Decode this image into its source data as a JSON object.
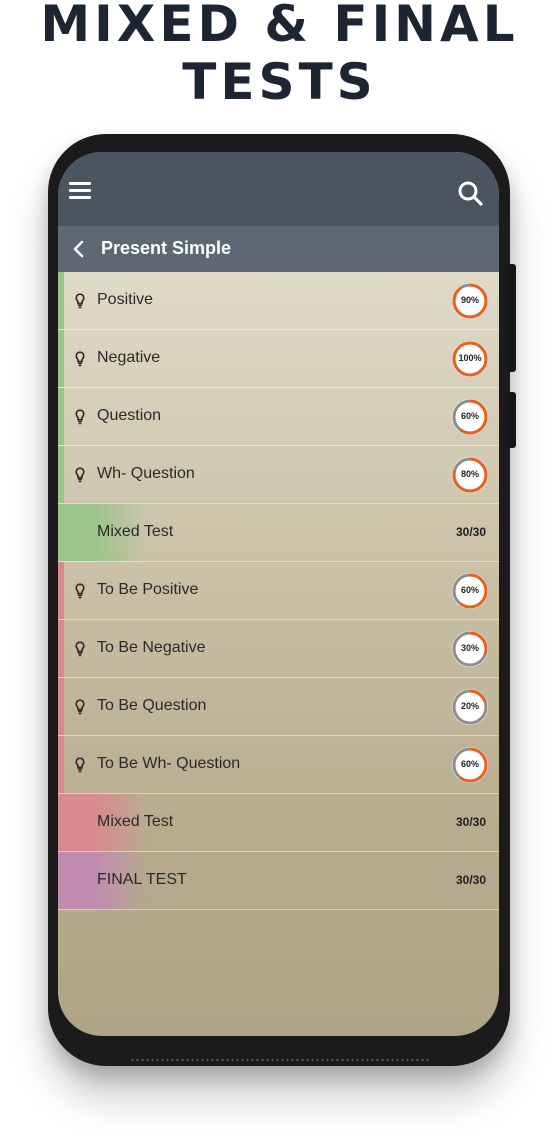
{
  "headline": {
    "line1": "MIXED & FINAL",
    "line2": "TESTS"
  },
  "appbar": {
    "menu_icon": "hamburger-menu-icon",
    "search_icon": "search-icon"
  },
  "subbar": {
    "back_icon": "chevron-left-icon",
    "title": "Present Simple"
  },
  "colors": {
    "appbar": "#4b5561",
    "subbar": "#5e6874",
    "ring_progress": "#e8611e",
    "ring_track": "#8d8d8d",
    "green_accent": "#9bc488",
    "red_accent": "#d88a8e",
    "purple_accent": "#c18bb0"
  },
  "list": [
    {
      "label": "Positive",
      "kind": "lesson",
      "percent_text": "90%",
      "progress": 0.9,
      "accent": "green"
    },
    {
      "label": "Negative",
      "kind": "lesson",
      "percent_text": "100%",
      "progress": 1.0,
      "accent": "green"
    },
    {
      "label": "Question",
      "kind": "lesson",
      "percent_text": "60%",
      "progress": 0.6,
      "accent": "green"
    },
    {
      "label": "Wh- Question",
      "kind": "lesson",
      "percent_text": "80%",
      "progress": 0.8,
      "accent": "green"
    },
    {
      "label": "Mixed Test",
      "kind": "test",
      "score": "30/30",
      "accent": "green"
    },
    {
      "label": "To Be Positive",
      "kind": "lesson",
      "percent_text": "60%",
      "progress": 0.6,
      "accent": "red"
    },
    {
      "label": "To Be Negative",
      "kind": "lesson",
      "percent_text": "30%",
      "progress": 0.3,
      "accent": "red"
    },
    {
      "label": "To Be Question",
      "kind": "lesson",
      "percent_text": "20%",
      "progress": 0.2,
      "accent": "red"
    },
    {
      "label": "To Be Wh- Question",
      "kind": "lesson",
      "percent_text": "60%",
      "progress": 0.6,
      "accent": "red"
    },
    {
      "label": "Mixed Test",
      "kind": "test",
      "score": "30/30",
      "accent": "red"
    },
    {
      "label": "FINAL TEST",
      "kind": "test",
      "score": "30/30",
      "accent": "purple"
    }
  ]
}
